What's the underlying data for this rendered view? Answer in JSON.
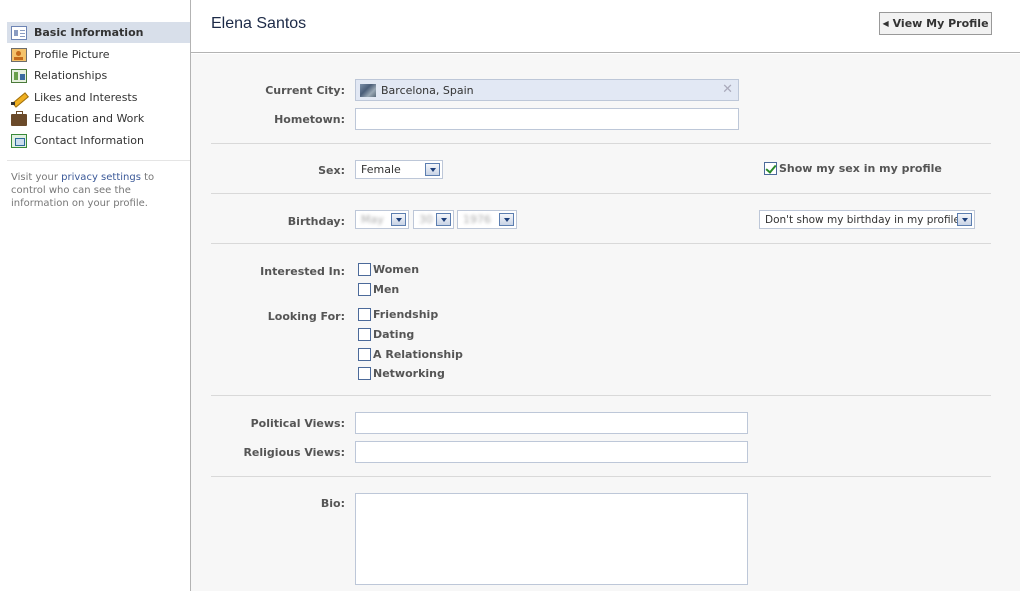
{
  "sidebar": {
    "items": [
      {
        "label": "Basic Information",
        "icon": "id-card-icon",
        "active": true
      },
      {
        "label": "Profile Picture",
        "icon": "profile-picture-icon",
        "active": false
      },
      {
        "label": "Relationships",
        "icon": "relationships-icon",
        "active": false
      },
      {
        "label": "Likes and Interests",
        "icon": "pencil-icon",
        "active": false
      },
      {
        "label": "Education and Work",
        "icon": "briefcase-icon",
        "active": false
      },
      {
        "label": "Contact Information",
        "icon": "contact-icon",
        "active": false
      }
    ],
    "privacy_prefix": "Visit your ",
    "privacy_link": "privacy settings",
    "privacy_suffix": " to control who can see the information on your profile."
  },
  "header": {
    "title": "Elena Santos",
    "view_profile_label": "View My Profile"
  },
  "form": {
    "current_city": {
      "label": "Current City:",
      "value": "Barcelona, Spain"
    },
    "hometown": {
      "label": "Hometown:",
      "value": ""
    },
    "sex": {
      "label": "Sex:",
      "value": "Female",
      "show_label": "Show my sex in my profile",
      "show_checked": true
    },
    "birthday": {
      "label": "Birthday:",
      "month": "May",
      "day": "30",
      "year": "1976",
      "visibility": "Don't show my birthday in my profile."
    },
    "interested_in": {
      "label": "Interested In:",
      "options": [
        "Women",
        "Men"
      ]
    },
    "looking_for": {
      "label": "Looking For:",
      "options": [
        "Friendship",
        "Dating",
        "A Relationship",
        "Networking"
      ]
    },
    "political_views": {
      "label": "Political Views:",
      "value": ""
    },
    "religious_views": {
      "label": "Religious Views:",
      "value": ""
    },
    "bio": {
      "label": "Bio:",
      "value": ""
    }
  },
  "colors": {
    "link": "#3b5998",
    "active_nav": "#d8dfea",
    "input_border": "#bdc7d8",
    "main_bg": "#f7f7f7"
  }
}
